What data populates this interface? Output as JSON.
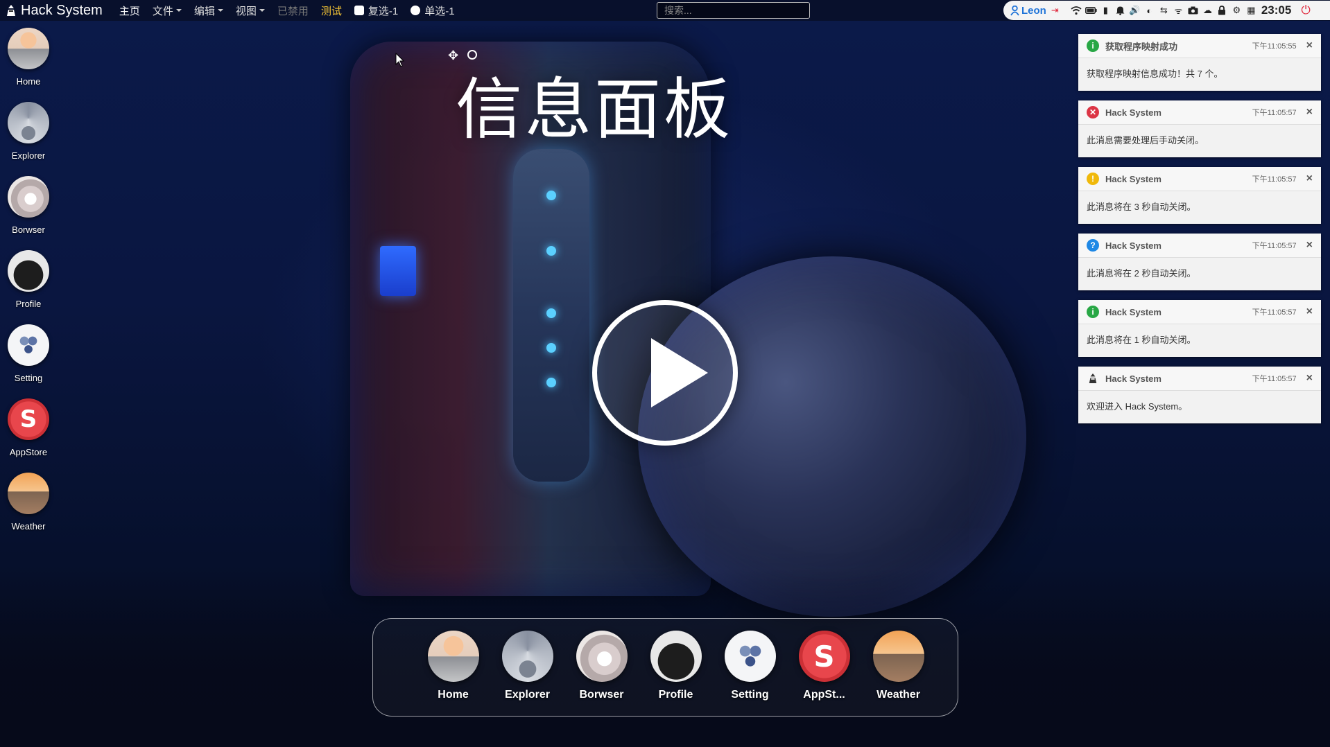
{
  "topbar": {
    "brand": "Hack System",
    "menu": [
      {
        "label": "主页",
        "state": "active",
        "dropdown": false
      },
      {
        "label": "文件",
        "state": "normal",
        "dropdown": true
      },
      {
        "label": "编辑",
        "state": "normal",
        "dropdown": true
      },
      {
        "label": "视图",
        "state": "normal",
        "dropdown": true
      },
      {
        "label": "已禁用",
        "state": "disabled",
        "dropdown": false
      },
      {
        "label": "测试",
        "state": "highlight",
        "dropdown": false
      }
    ],
    "checkbox_label": "复选-1",
    "radio_label": "单选-1",
    "search_placeholder": "搜索...",
    "tray": {
      "user": "Leon",
      "icons": [
        "wifi-icon",
        "battery-icon",
        "phone-icon",
        "bell-icon",
        "volume-icon",
        "contrast-icon",
        "usb-icon",
        "signal-icon",
        "camera-icon",
        "cloud-icon",
        "lock-icon",
        "gear-icon",
        "calendar-icon"
      ],
      "clock": "23:05",
      "power_icon": "power-icon"
    }
  },
  "desktop_icons": [
    {
      "label": "Home",
      "icon": "home-icon"
    },
    {
      "label": "Explorer",
      "icon": "explorer-icon"
    },
    {
      "label": "Borwser",
      "icon": "browser-icon"
    },
    {
      "label": "Profile",
      "icon": "profile-icon"
    },
    {
      "label": "Setting",
      "icon": "setting-icon"
    },
    {
      "label": "AppStore",
      "icon": "appstore-icon"
    },
    {
      "label": "Weather",
      "icon": "weather-icon"
    }
  ],
  "main": {
    "title": "信息面板"
  },
  "notifications": [
    {
      "type": "success",
      "title": "获取程序映射成功",
      "time": "下午11:05:55",
      "message": "获取程序映射信息成功！共 7 个。"
    },
    {
      "type": "error",
      "title": "Hack System",
      "time": "下午11:05:57",
      "message": "此消息需要处理后手动关闭。"
    },
    {
      "type": "warn",
      "title": "Hack System",
      "time": "下午11:05:57",
      "message": "此消息将在 3 秒自动关闭。"
    },
    {
      "type": "info",
      "title": "Hack System",
      "time": "下午11:05:57",
      "message": "此消息将在 2 秒自动关闭。"
    },
    {
      "type": "success",
      "title": "Hack System",
      "time": "下午11:05:57",
      "message": "此消息将在 1 秒自动关闭。"
    },
    {
      "type": "app",
      "title": "Hack System",
      "time": "下午11:05:57",
      "message": "欢迎进入 Hack System。"
    }
  ],
  "dock": [
    {
      "label": "Home",
      "icon": "home-icon"
    },
    {
      "label": "Explorer",
      "icon": "explorer-icon"
    },
    {
      "label": "Borwser",
      "icon": "browser-icon"
    },
    {
      "label": "Profile",
      "icon": "profile-icon"
    },
    {
      "label": "Setting",
      "icon": "setting-icon"
    },
    {
      "label": "AppSt...",
      "icon": "appstore-icon"
    },
    {
      "label": "Weather",
      "icon": "weather-icon"
    }
  ],
  "colors": {
    "accent_yellow": "#f3c334",
    "user_blue": "#1e73d8",
    "power_red": "#e0283c"
  }
}
